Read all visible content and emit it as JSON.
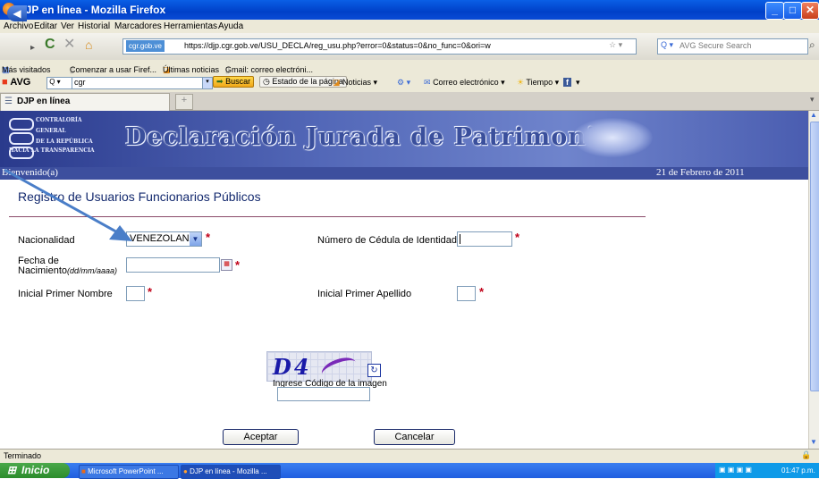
{
  "window": {
    "title": "DJP en línea - Mozilla Firefox"
  },
  "menubar": {
    "items": [
      "Archivo",
      "Editar",
      "Ver",
      "Historial",
      "Marcadores",
      "Herramientas",
      "Ayuda"
    ]
  },
  "navbar": {
    "site_label": "cgr.gob.ve",
    "url": "https://djp.cgr.gob.ve/USU_DECLA/reg_usu.php?error=0&status=0&no_func=0&ori=w",
    "search_placeholder": "AVG Secure Search"
  },
  "bookmarks": [
    "Más visitados",
    "Comenzar a usar Firef...",
    "Últimas noticias",
    "Gmail: correo electróni..."
  ],
  "avgbar": {
    "brand": "AVG",
    "search_value": "cgr",
    "buscar": "Buscar",
    "estado": "Estado de la página",
    "noticias": "Noticias",
    "correo": "Correo electrónico",
    "tiempo": "Tiempo"
  },
  "tab": {
    "label": "DJP en línea"
  },
  "banner": {
    "title": "Declaración Jurada de Patrimonio",
    "logo_lines": [
      "CONTRALORÍA",
      "GENERAL",
      "DE LA REPÚBLICA",
      "HACIA LA TRANSPARENCIA"
    ],
    "welcome": "Bienvenido(a)",
    "date": "21 de Febrero de 2011"
  },
  "form": {
    "title": "Registro de Usuarios Funcionarios Públicos",
    "nacionalidad_label": "Nacionalidad",
    "nacionalidad_value": "VENEZOLANA",
    "cedula_label": "Número de Cédula de Identidad",
    "fecha_label_1": "Fecha de",
    "fecha_label_2": "Nacimiento",
    "fecha_hint": "(dd/mm/aaaa)",
    "nombre_label": "Inicial Primer Nombre",
    "apellido_label": "Inicial Primer Apellido",
    "required_mark": "*",
    "captcha_text": "D4",
    "captcha_label": "Ingrese Código de la imagen",
    "accept": "Aceptar",
    "cancel": "Cancelar"
  },
  "status": {
    "text": "Terminado"
  },
  "taskbar": {
    "start": "Inicio",
    "tasks": [
      "Microsoft PowerPoint ...",
      "DJP en línea - Mozilla ..."
    ],
    "clock": "01:47 p.m."
  }
}
